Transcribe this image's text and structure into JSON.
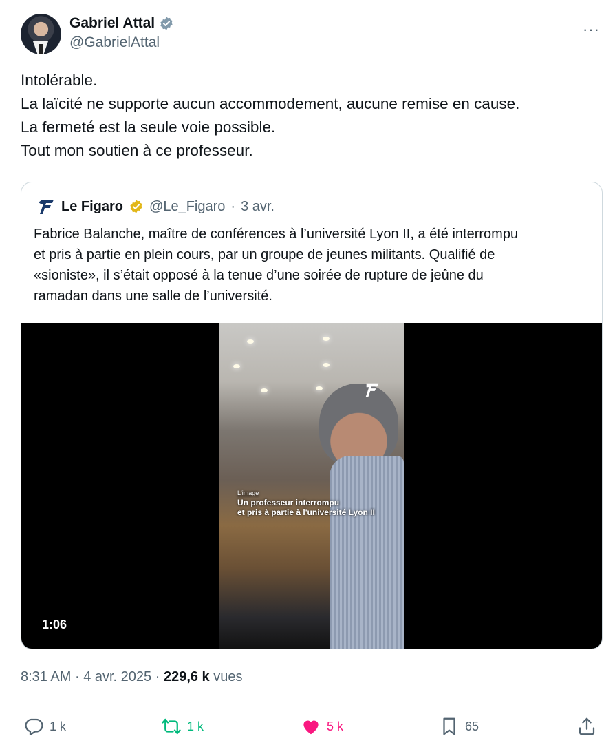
{
  "author": {
    "name": "Gabriel Attal",
    "handle": "@GabrielAttal",
    "verified": true
  },
  "more_label": "···",
  "tweet": {
    "lines": [
      "Intolérable.",
      "La laïcité ne supporte aucun accommodement, aucune remise en cause.",
      "La fermeté est la seule voie possible.",
      "Tout mon soutien à ce professeur."
    ]
  },
  "quote": {
    "name": "Le Figaro",
    "handle": "@Le_Figaro",
    "separator": "·",
    "date": "3 avr.",
    "lines": [
      "Fabrice Balanche, maître de conférences à l’université Lyon II, a été interrompu",
      "et pris à partie en plein cours, par un groupe de jeunes militants. Qualifié de",
      "«sioniste», il s’était opposé à la tenue d’une soirée de rupture de jeûne du",
      "ramadan dans une salle de l’université."
    ],
    "video": {
      "duration": "1:06",
      "overlay_small": "L'image",
      "overlay_line1": "Un professeur interrompu",
      "overlay_line2": "et pris à partie à l'université Lyon II"
    }
  },
  "meta": {
    "time": "8:31 AM",
    "sep": "·",
    "date": "4 avr. 2025",
    "sep2": "·",
    "views": "229,6 k",
    "views_label": "vues"
  },
  "actions": {
    "reply": "1 k",
    "retweet": "1 k",
    "like": "5 k",
    "bookmark": "65"
  },
  "colors": {
    "accent_blue": "#1d9bf0",
    "retweet_green": "#00ba7c",
    "like_pink": "#f91880",
    "secondary_text": "#536471",
    "gold_badge": "#e2b719",
    "grey_badge": "#829aab"
  }
}
